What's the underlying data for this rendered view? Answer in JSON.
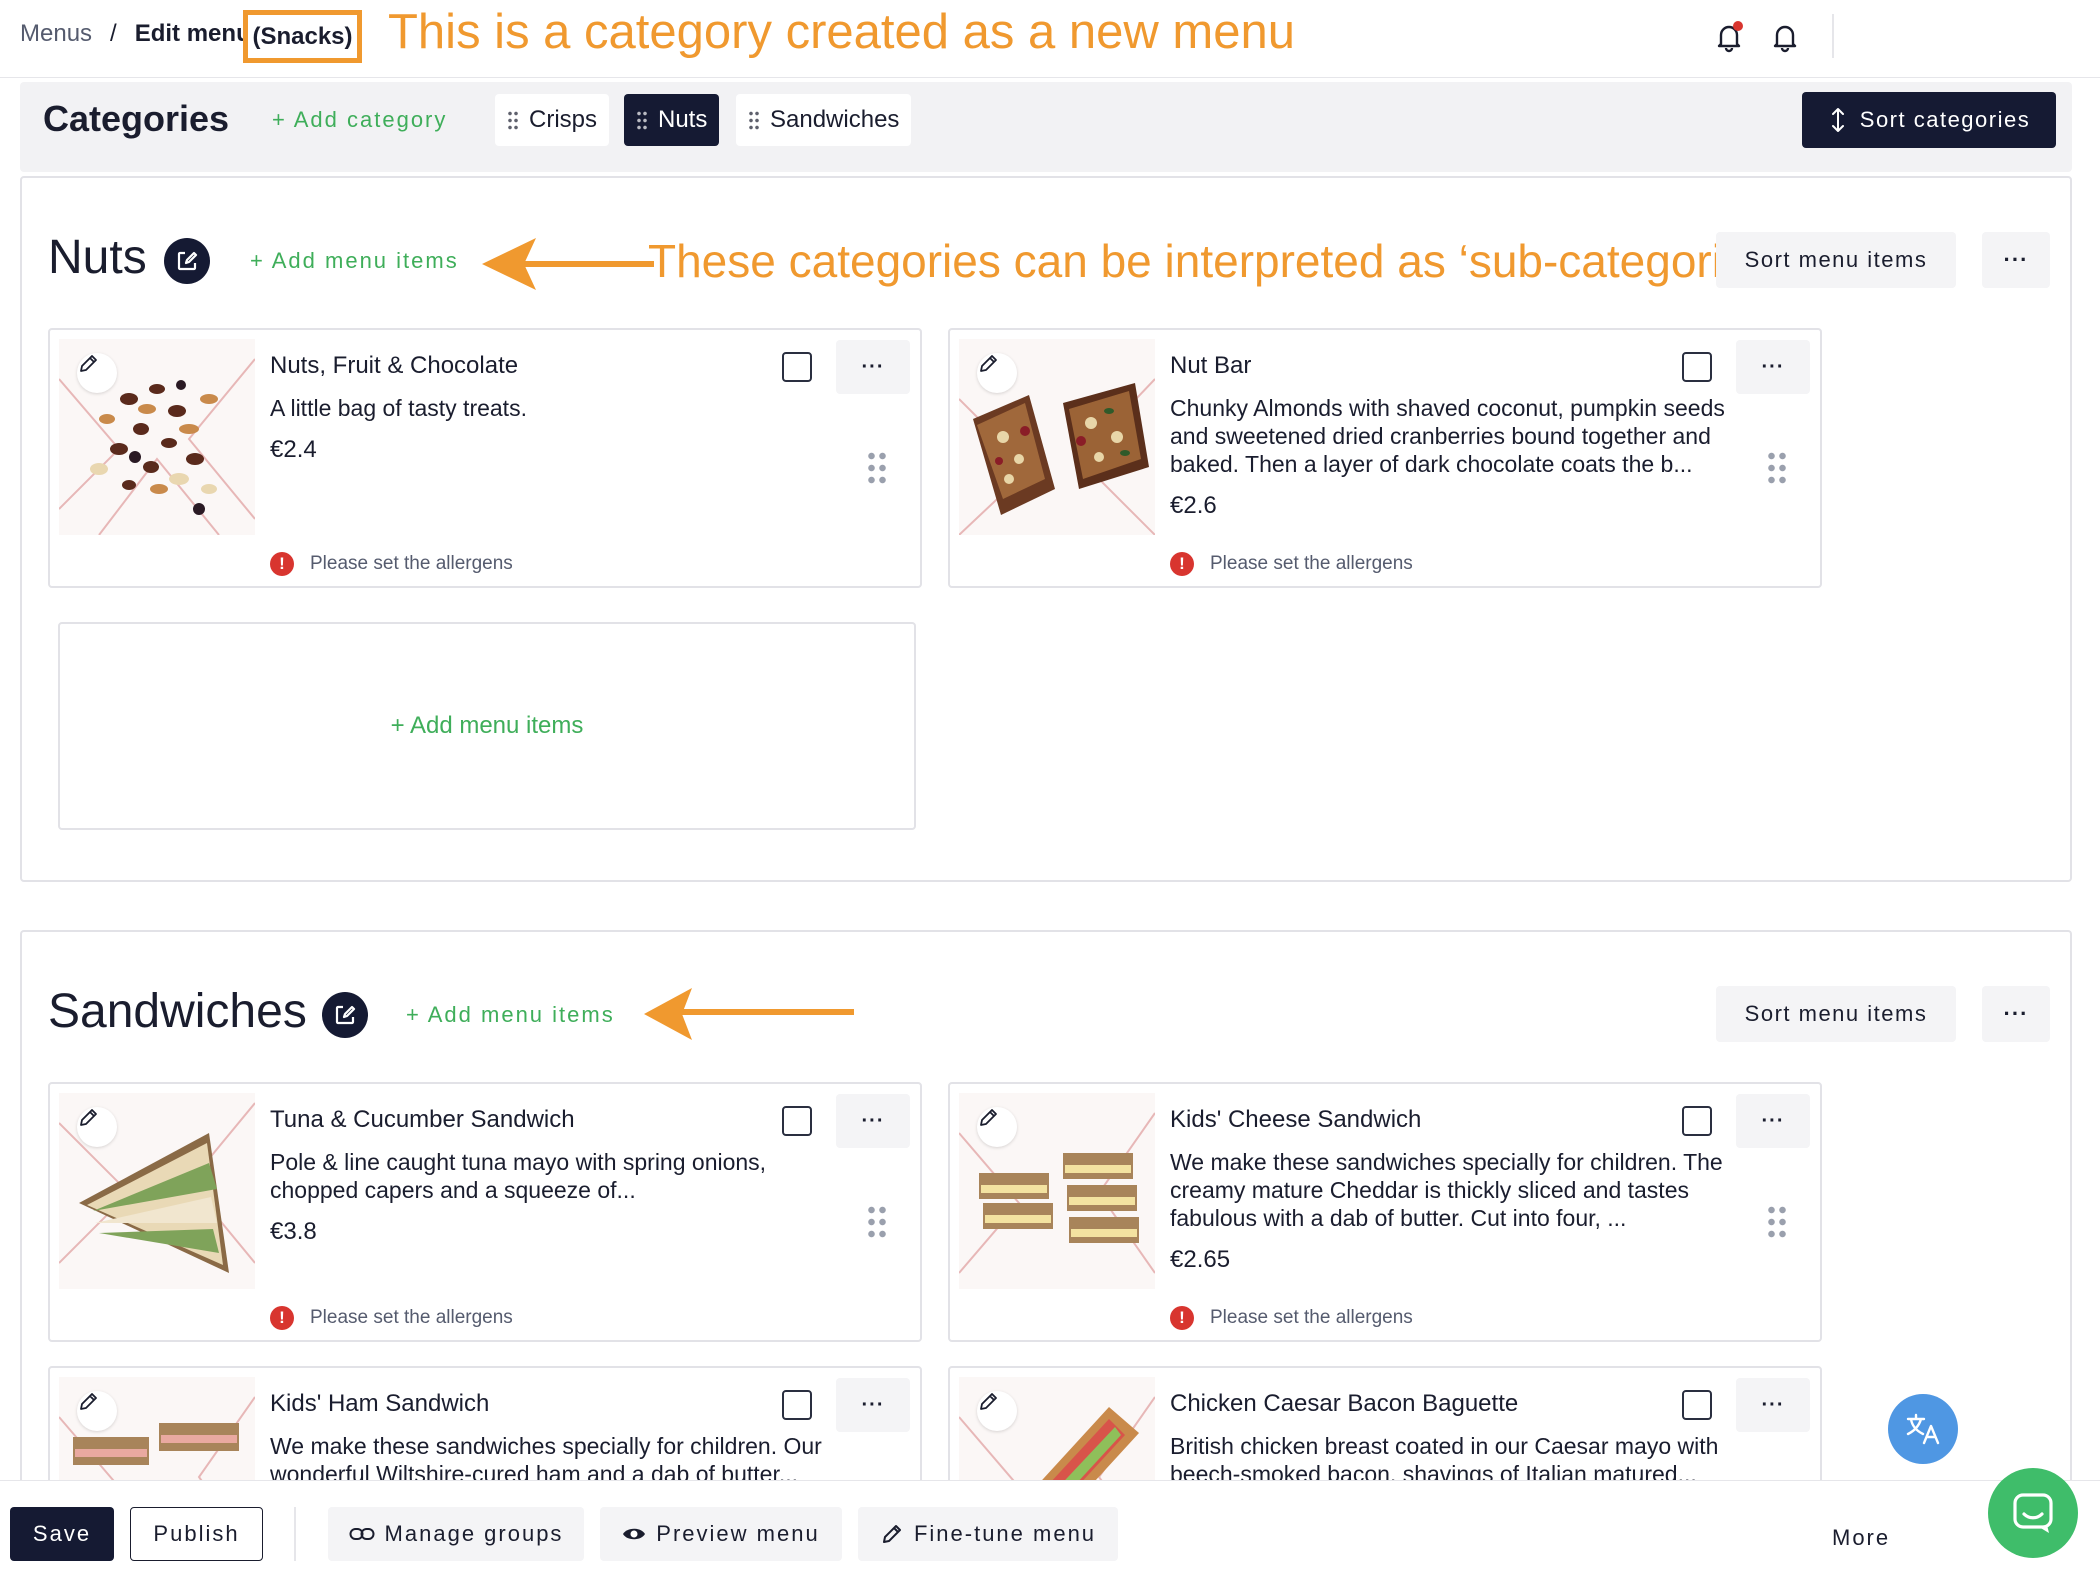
{
  "breadcrumb": {
    "root": "Menus",
    "separator": "/",
    "current": "Edit menu",
    "highlight": "(Snacks)"
  },
  "annotations": {
    "top": "This is a category created as a new menu",
    "nuts_note": "These categories can be interpreted as ‘sub-categories"
  },
  "header_icons": [
    "bell-alert-icon",
    "bell-icon"
  ],
  "categories_bar": {
    "title": "Categories",
    "add_label": "+ Add category",
    "chips": [
      {
        "label": "Crisps",
        "active": false
      },
      {
        "label": "Nuts",
        "active": true
      },
      {
        "label": "Sandwiches",
        "active": false
      }
    ],
    "sort_label": "Sort categories"
  },
  "sections": [
    {
      "title": "Nuts",
      "add_label": "+ Add menu items",
      "sort_label": "Sort menu items",
      "more_label": "···",
      "add_box_label": "+ Add menu items",
      "items": [
        {
          "name": "Nuts, Fruit & Chocolate",
          "description": "A little bag of tasty treats.",
          "price": "€2.4",
          "warning": "Please set the allergens"
        },
        {
          "name": "Nut Bar",
          "description": "Chunky Almonds with shaved coconut, pumpkin seeds and sweetened dried cranberries bound together and baked. Then a layer of dark chocolate coats the b...",
          "price": "€2.6",
          "warning": "Please set the allergens"
        }
      ]
    },
    {
      "title": "Sandwiches",
      "add_label": "+ Add menu items",
      "sort_label": "Sort menu items",
      "more_label": "···",
      "items": [
        {
          "name": "Tuna & Cucumber Sandwich",
          "description": "Pole & line caught tuna mayo with spring onions, chopped capers and a squeeze of...",
          "price": "€3.8",
          "warning": "Please set the allergens"
        },
        {
          "name": "Kids' Cheese Sandwich",
          "description": "We make these sandwiches specially for children. The creamy mature Cheddar is thickly sliced and tastes fabulous with a dab of butter. Cut into four, ...",
          "price": "€2.65",
          "warning": "Please set the allergens"
        },
        {
          "name": "Kids' Ham Sandwich",
          "description": "We make these sandwiches specially for children. Our wonderful Wiltshire-cured ham and a dab of butter..."
        },
        {
          "name": "Chicken Caesar Bacon Baguette",
          "description": "British chicken breast coated in our Caesar mayo with beech-smoked bacon, shavings of Italian matured..."
        }
      ]
    }
  ],
  "item_more_label": "···",
  "bottom_bar": {
    "save": "Save",
    "publish": "Publish",
    "manage_groups": "Manage groups",
    "preview": "Preview menu",
    "fine_tune": "Fine-tune menu",
    "more": "More"
  },
  "floating": {
    "translate_icon": "translate-icon",
    "chat_icon": "chat-icon"
  },
  "colors": {
    "accent_green": "#3fae5a",
    "dark_navy": "#151a33",
    "annotation_orange": "#f0992f",
    "warning_red": "#d8352f"
  }
}
